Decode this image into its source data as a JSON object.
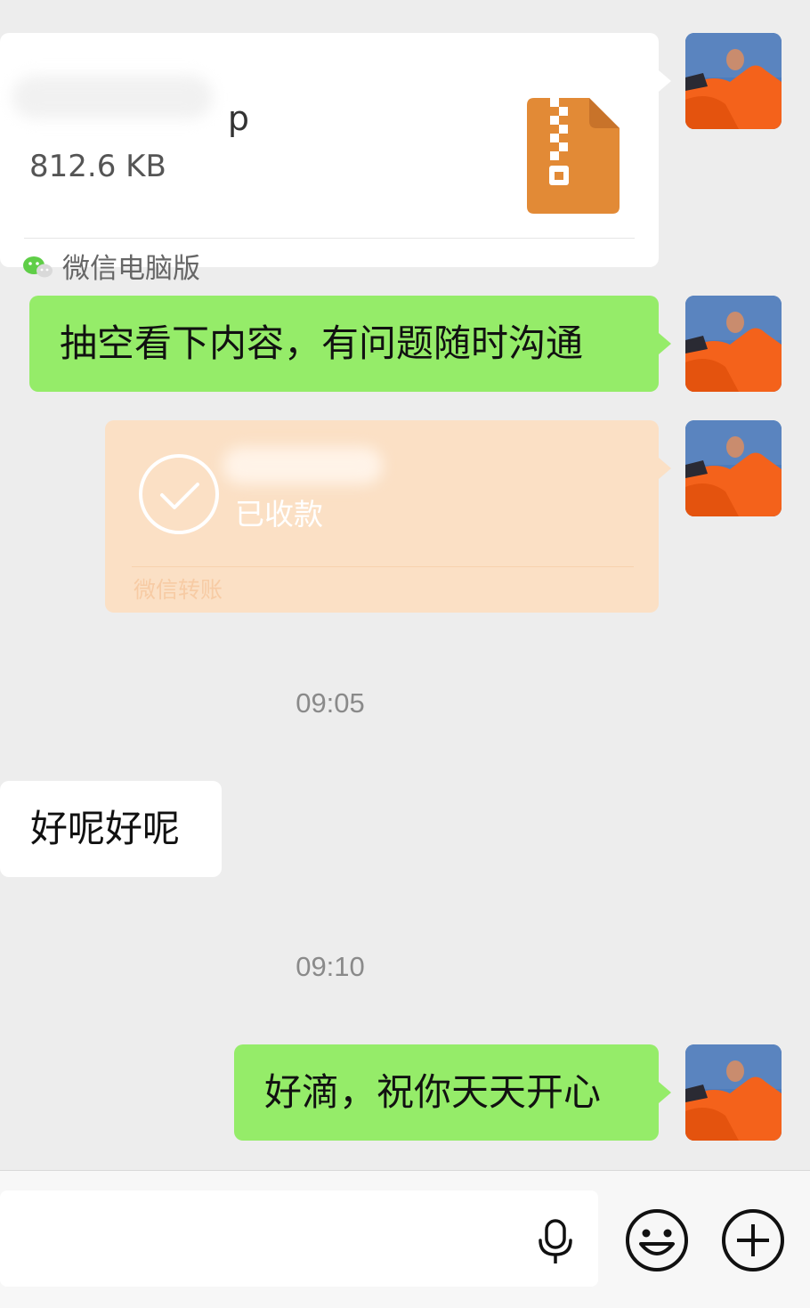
{
  "file_message": {
    "file_name": "p",
    "file_size": "812.6 KB",
    "source": "微信电脑版",
    "icon": "zip-file-icon"
  },
  "text_message_1": "抽空看下内容，有问题随时沟通",
  "transfer_message": {
    "status": "已收款",
    "source": "微信转账",
    "icon": "check-circle-icon"
  },
  "timestamp_1": "09:05",
  "incoming_message": "好呢好呢",
  "timestamp_2": "09:10",
  "text_message_2": "好滴，祝你天天开心",
  "input_bar": {
    "voice_icon": "microphone-icon",
    "emoji_icon": "emoji-icon",
    "more_icon": "plus-circle-icon"
  },
  "colors": {
    "background": "#ededed",
    "bubble_green": "#95ec69",
    "transfer_card": "#fbe0c5",
    "zip_orange": "#e28a36"
  }
}
